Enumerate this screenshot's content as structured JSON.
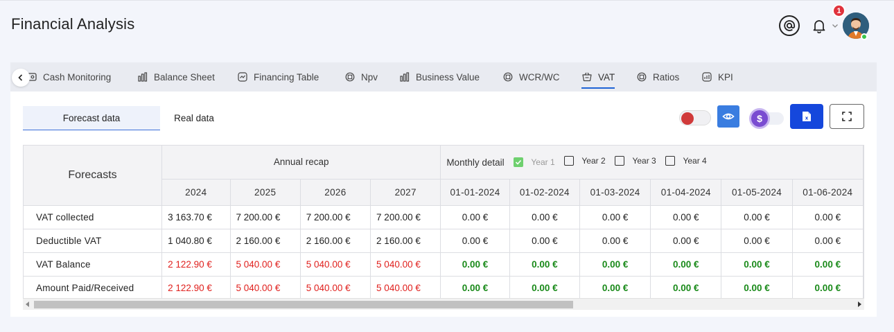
{
  "header": {
    "title": "Financial Analysis",
    "notification_count": "1"
  },
  "tabs": [
    {
      "label": "Cash Monitoring",
      "icon": "cash-icon"
    },
    {
      "label": "Balance Sheet",
      "icon": "bar-chart-icon"
    },
    {
      "label": "Financing Table",
      "icon": "financing-icon"
    },
    {
      "label": "Npv",
      "icon": "npv-icon"
    },
    {
      "label": "Business Value",
      "icon": "bar-chart-icon"
    },
    {
      "label": "WCR/WC",
      "icon": "wcr-icon"
    },
    {
      "label": "VAT",
      "icon": "basket-icon",
      "active": true
    },
    {
      "label": "Ratios",
      "icon": "ratios-icon"
    },
    {
      "label": "KPI",
      "icon": "kpi-icon"
    }
  ],
  "segments": {
    "forecast": "Forecast data",
    "real": "Real data"
  },
  "excel_label": "x",
  "dollar_symbol": "$",
  "table": {
    "corner_label": "Forecasts",
    "annual_label": "Annual recap",
    "monthly_label": "Monthly detail",
    "year_checks": [
      {
        "label": "Year 1",
        "checked": true
      },
      {
        "label": "Year 2",
        "checked": false
      },
      {
        "label": "Year 3",
        "checked": false
      },
      {
        "label": "Year 4",
        "checked": false
      }
    ],
    "years": [
      "2024",
      "2025",
      "2026",
      "2027"
    ],
    "months": [
      "01-01-2024",
      "01-02-2024",
      "01-03-2024",
      "01-04-2024",
      "01-05-2024",
      "01-06-2024"
    ],
    "rows": [
      {
        "label": "VAT collected",
        "annual": [
          "3 163.70 €",
          "7 200.00 €",
          "7 200.00 €",
          "7 200.00 €"
        ],
        "monthly": [
          "0.00 €",
          "0.00 €",
          "0.00 €",
          "0.00 €",
          "0.00 €",
          "0.00 €"
        ],
        "style": "normal"
      },
      {
        "label": "Deductible VAT",
        "annual": [
          "1 040.80 €",
          "2 160.00 €",
          "2 160.00 €",
          "2 160.00 €"
        ],
        "monthly": [
          "0.00 €",
          "0.00 €",
          "0.00 €",
          "0.00 €",
          "0.00 €",
          "0.00 €"
        ],
        "style": "normal"
      },
      {
        "label": "VAT Balance",
        "annual": [
          "2 122.90 €",
          "5 040.00 €",
          "5 040.00 €",
          "5 040.00 €"
        ],
        "monthly": [
          "0.00 €",
          "0.00 €",
          "0.00 €",
          "0.00 €",
          "0.00 €",
          "0.00 €"
        ],
        "style": "colored"
      },
      {
        "label": "Amount Paid/Received",
        "annual": [
          "2 122.90 €",
          "5 040.00 €",
          "5 040.00 €",
          "5 040.00 €"
        ],
        "monthly": [
          "0.00 €",
          "0.00 €",
          "0.00 €",
          "0.00 €",
          "0.00 €",
          "0.00 €"
        ],
        "style": "colored"
      }
    ]
  },
  "colors": {
    "accent": "#1e63d6",
    "negative": "#e0201d",
    "positive": "#1a8a1a",
    "excel": "#1547dc"
  }
}
